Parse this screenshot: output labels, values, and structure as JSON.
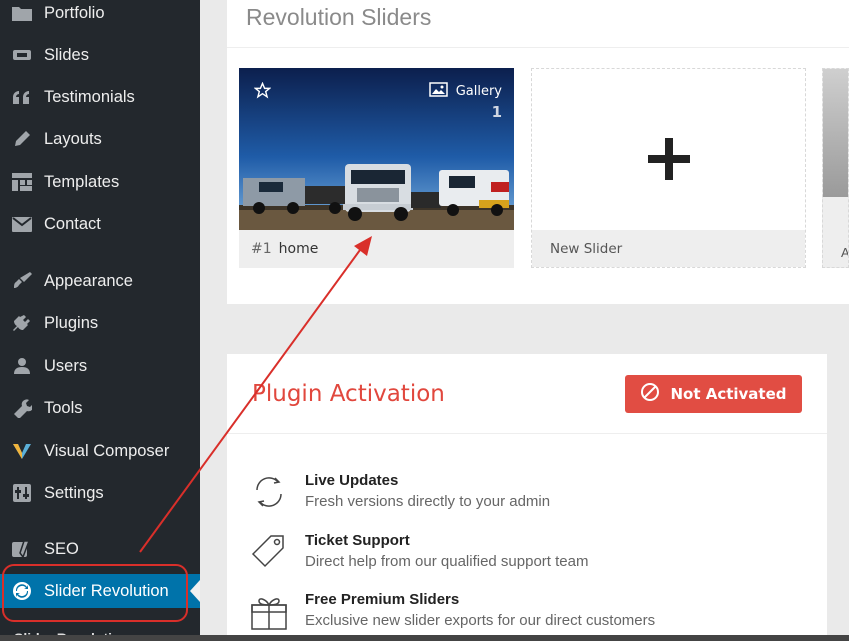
{
  "sidebar": {
    "items": [
      {
        "label": "Portfolio",
        "icon": "folder-icon"
      },
      {
        "label": "Slides",
        "icon": "slides-icon"
      },
      {
        "label": "Testimonials",
        "icon": "quote-icon"
      },
      {
        "label": "Layouts",
        "icon": "pencil-icon"
      },
      {
        "label": "Templates",
        "icon": "templates-icon"
      },
      {
        "label": "Contact",
        "icon": "mail-icon"
      },
      {
        "label": "Appearance",
        "icon": "brush-icon"
      },
      {
        "label": "Plugins",
        "icon": "plug-icon"
      },
      {
        "label": "Users",
        "icon": "user-icon"
      },
      {
        "label": "Tools",
        "icon": "wrench-icon"
      },
      {
        "label": "Visual Composer",
        "icon": "visual-composer-icon"
      },
      {
        "label": "Settings",
        "icon": "settings-icon"
      },
      {
        "label": "SEO",
        "icon": "seo-icon"
      },
      {
        "label": "Slider Revolution",
        "icon": "refresh-icon",
        "active": true
      }
    ],
    "submenu_label": "Slider Revolution"
  },
  "sliders": {
    "title": "Revolution Sliders",
    "cards": [
      {
        "number": "#1",
        "name": "home",
        "type": "Gallery",
        "count": "1"
      },
      {
        "label": "New Slider"
      },
      {
        "label": "A"
      }
    ]
  },
  "activation": {
    "title": "Plugin Activation",
    "status_button": "Not Activated",
    "features": [
      {
        "title": "Live Updates",
        "desc": "Fresh versions directly to your admin",
        "icon": "sync-icon"
      },
      {
        "title": "Ticket Support",
        "desc": "Direct help from our qualified support team",
        "icon": "tag-icon"
      },
      {
        "title": "Free Premium Sliders",
        "desc": "Exclusive new slider exports for our direct customers",
        "icon": "gift-icon"
      }
    ]
  },
  "colors": {
    "sidebar_bg": "#23282d",
    "active_bg": "#0073aa",
    "accent_red": "#e14d43",
    "annotation_red": "#d92f2a"
  }
}
